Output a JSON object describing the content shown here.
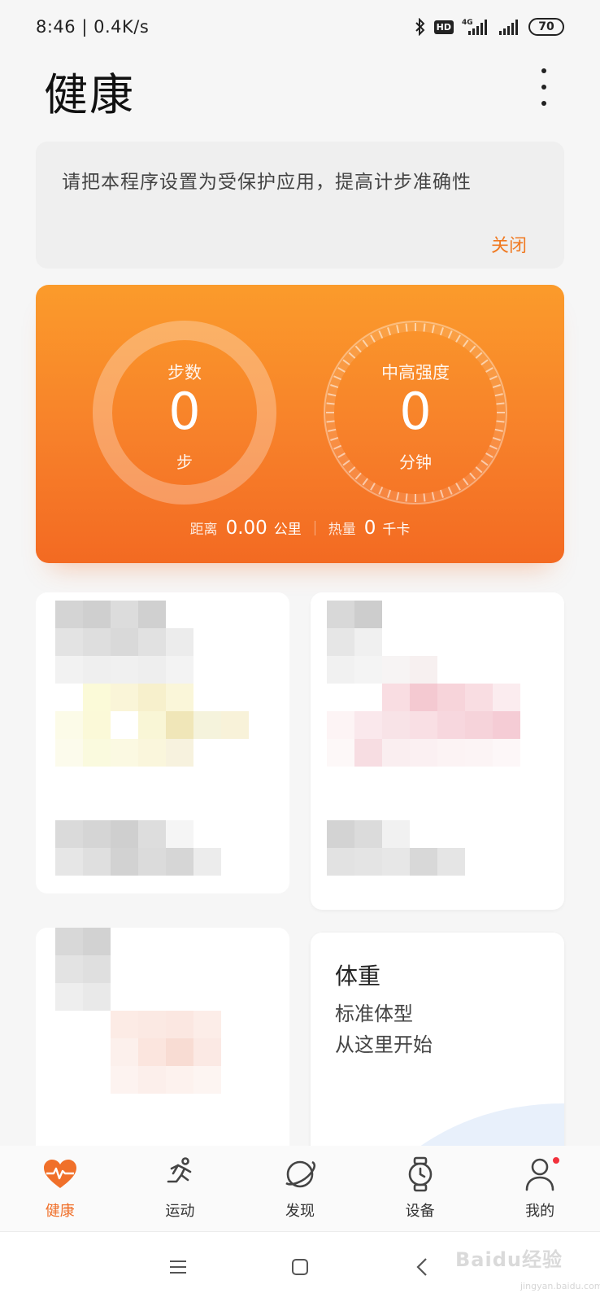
{
  "status_bar": {
    "time": "8:46",
    "network_speed": "0.4K/s",
    "hd": "HD",
    "network_type": "4G",
    "battery": "70"
  },
  "header": {
    "title": "健康"
  },
  "notice": {
    "text": "请把本程序设置为受保护应用，提高计步准确性",
    "close_label": "关闭"
  },
  "summary": {
    "steps": {
      "label": "步数",
      "value": "0",
      "unit": "步"
    },
    "intensity": {
      "label": "中高强度",
      "value": "0",
      "unit": "分钟"
    },
    "distance": {
      "label": "距离",
      "value": "0.00",
      "unit": "公里"
    },
    "calories": {
      "label": "热量",
      "value": "0",
      "unit": "千卡"
    }
  },
  "weight_card": {
    "title": "体重",
    "line1": "标准体型",
    "line2": "从这里开始"
  },
  "tabs": [
    {
      "label": "健康",
      "icon": "heart-pulse-icon",
      "active": true
    },
    {
      "label": "运动",
      "icon": "running-icon",
      "active": false
    },
    {
      "label": "发现",
      "icon": "planet-icon",
      "active": false
    },
    {
      "label": "设备",
      "icon": "watch-icon",
      "active": false
    },
    {
      "label": "我的",
      "icon": "person-icon",
      "active": false,
      "badge": true
    }
  ],
  "watermark": {
    "text": "Baidu经验",
    "sub": "jingyan.baidu.com"
  },
  "colors": {
    "accent": "#f0702a",
    "card_gradient_top": "#fb9b2b",
    "card_gradient_bottom": "#f36a22",
    "badge": "#f2313c"
  }
}
